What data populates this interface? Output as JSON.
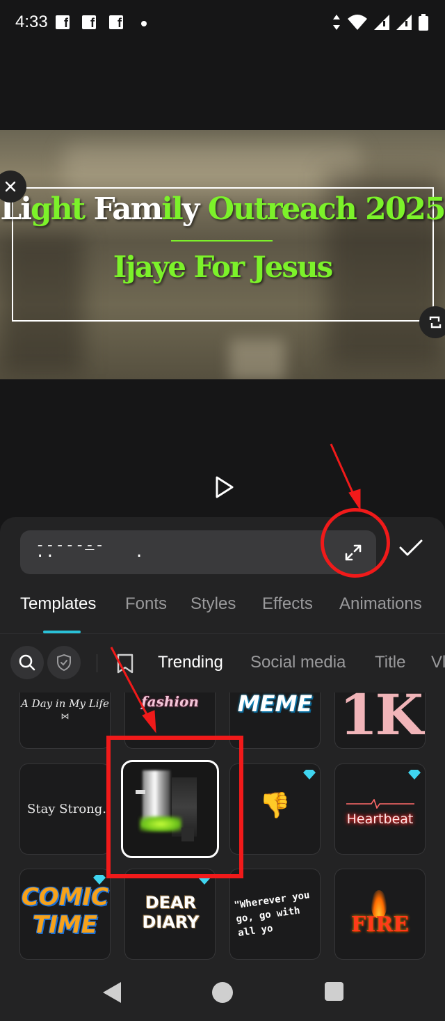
{
  "status_bar": {
    "time": "4:33",
    "notification_icons": [
      "facebook-icon",
      "facebook-icon",
      "facebook-icon"
    ],
    "system_icons": [
      "data-arrows-icon",
      "wifi-icon",
      "signal-icon",
      "signal-icon",
      "battery-icon"
    ]
  },
  "preview": {
    "title_line1": {
      "white_a": "Li",
      "green_a": "ght",
      "white_b": " Fam",
      "green_b": "il",
      "white_c": "y",
      "green_c": " Outreach 2025"
    },
    "title_line2": "Ijaye For Jesus",
    "accent_color": "#7cf22a"
  },
  "editor": {
    "text_value": "-------\n··   ‾    ·",
    "confirm_icon": "check-icon",
    "expand_icon": "expand-icon"
  },
  "tabs": {
    "items": [
      "Templates",
      "Fonts",
      "Styles",
      "Effects",
      "Animations"
    ],
    "active": "Templates",
    "underline_color": "#2ac1d8"
  },
  "filters": {
    "search_icon": "search-icon",
    "shield_icon": "shield-check-icon",
    "bookmark_icon": "bookmark-icon",
    "categories": [
      "Trending",
      "Social media",
      "Title",
      "Vl"
    ],
    "active": "Trending"
  },
  "templates": {
    "row1": [
      "A Day in My Life",
      "fashion",
      "MEME",
      "1K"
    ],
    "row2": [
      "Stay Strong.",
      "",
      "",
      "Heartbeat"
    ],
    "row3": [
      "COMIC TIME",
      "DEAR DIARY",
      "\"Wherever you go, go with all yo",
      "FIRE"
    ],
    "premium_badge_color": "#3fd5f0"
  },
  "annotations": {
    "color": "#f11a1a"
  }
}
